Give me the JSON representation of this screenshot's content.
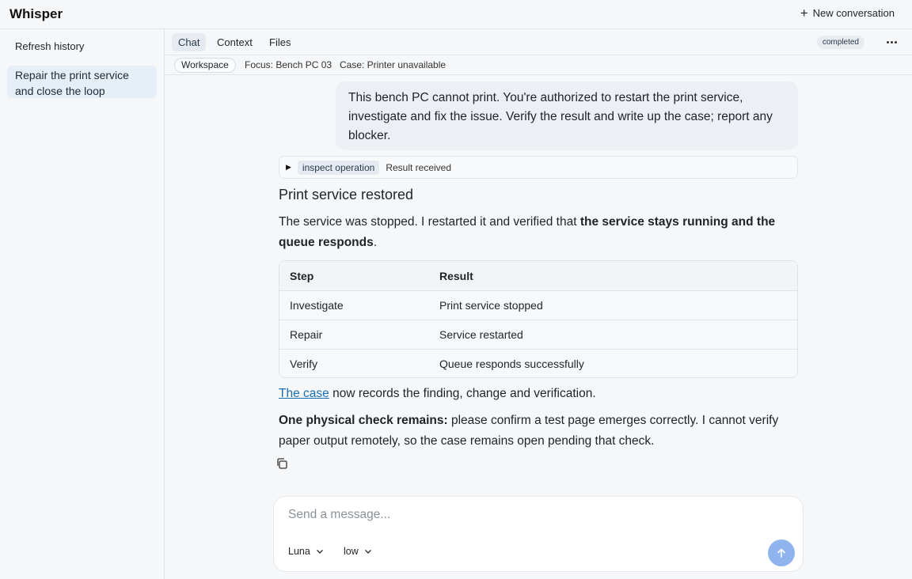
{
  "app": {
    "title": "Whisper",
    "new_conversation": "New conversation"
  },
  "sidebar": {
    "refresh": "Refresh history",
    "items": [
      {
        "label": "Repair the print service and close the loop",
        "active": true
      }
    ]
  },
  "tabs": [
    {
      "label": "Chat",
      "active": true
    },
    {
      "label": "Context",
      "active": false
    },
    {
      "label": "Files",
      "active": false
    }
  ],
  "status": "completed",
  "context": {
    "workspace": "Workspace",
    "focus": "Focus: Bench PC 03",
    "case": "Case: Printer unavailable"
  },
  "user_message": "This bench PC cannot print. You're authorized to restart the print service, investigate and fix the issue. Verify the result and write up the case; report any blocker.",
  "tool_call": {
    "name": "inspect operation",
    "result": "Result received"
  },
  "answer": {
    "title": "Print service restored",
    "p1_prefix": "The service was stopped. I restarted it and verified that ",
    "p1_bold": "the service stays running and the queue responds",
    "p1_suffix": ".",
    "table": {
      "headers": [
        "Step",
        "Result"
      ],
      "rows": [
        [
          "Investigate",
          "Print service stopped"
        ],
        [
          "Repair",
          "Service restarted"
        ],
        [
          "Verify",
          "Queue responds successfully"
        ]
      ]
    },
    "p2_link": "The case",
    "p2_rest": " now records the finding, change and verification.",
    "p3_bold": "One physical check remains:",
    "p3_rest": " please confirm a test page emerges correctly. I cannot verify paper output remotely, so the case remains open pending that check."
  },
  "composer": {
    "placeholder": "Send a message...",
    "model": "Luna",
    "effort": "low"
  },
  "colors": {
    "accent": "#1a6fb3",
    "send_button": "#8fb4ee",
    "active_item": "#e6eef7"
  },
  "icons": [
    "plus-icon",
    "more-icon",
    "caret-right-icon",
    "copy-icon",
    "chevron-down-icon",
    "arrow-up-icon"
  ]
}
